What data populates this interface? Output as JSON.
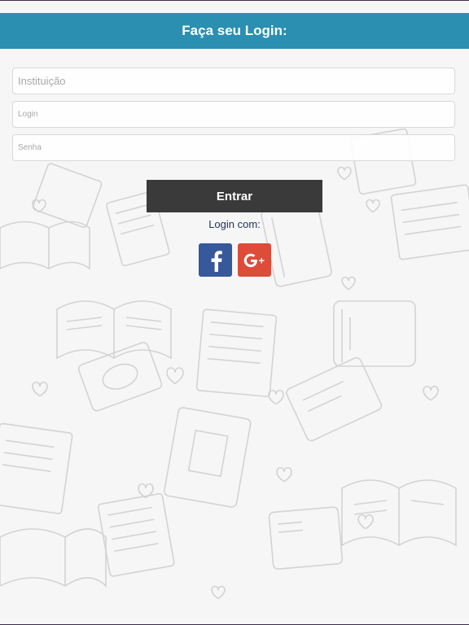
{
  "header": {
    "title": "Faça seu Login:"
  },
  "form": {
    "institution_placeholder": "Instituição",
    "login_placeholder": "Login",
    "password_placeholder": "Senha",
    "submit_label": "Entrar"
  },
  "social": {
    "label": "Login com:",
    "providers": [
      {
        "name": "facebook",
        "icon": "facebook-icon",
        "color": "#37589a"
      },
      {
        "name": "google-plus",
        "icon": "google-plus-icon",
        "color": "#dd4b39"
      }
    ]
  },
  "colors": {
    "header_bg": "#2b8fb1",
    "button_bg": "#3b3a3a",
    "link_text": "#20355c"
  }
}
